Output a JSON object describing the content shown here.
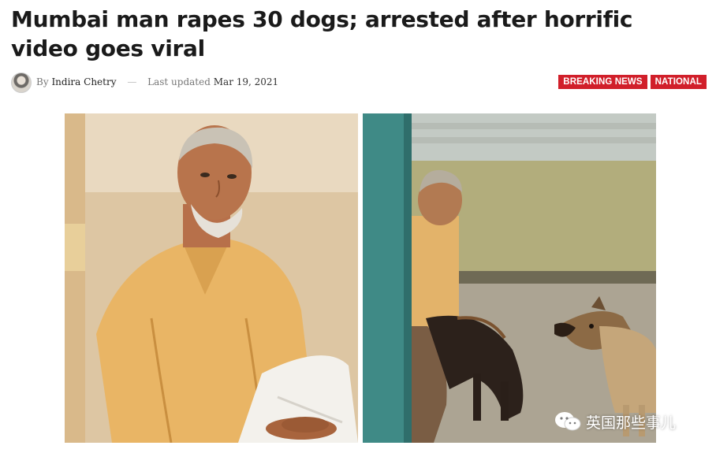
{
  "article": {
    "headline": "Mumbai man rapes 30 dogs; arrested after horrific video goes viral",
    "byline_prefix": "By",
    "author": "Indira Chetry",
    "separator": "—",
    "updated_label": "Last updated",
    "updated_date": "Mar 19, 2021",
    "tags": [
      "BREAKING NEWS",
      "NATIONAL"
    ]
  },
  "media": {
    "left_image": "man-portrait-photo",
    "right_image": "man-with-dogs-video-still"
  },
  "watermark": {
    "icon": "wechat-icon",
    "text": "英国那些事儿"
  },
  "colors": {
    "tag_bg": "#d11f2a",
    "headline": "#1a1a1a"
  }
}
